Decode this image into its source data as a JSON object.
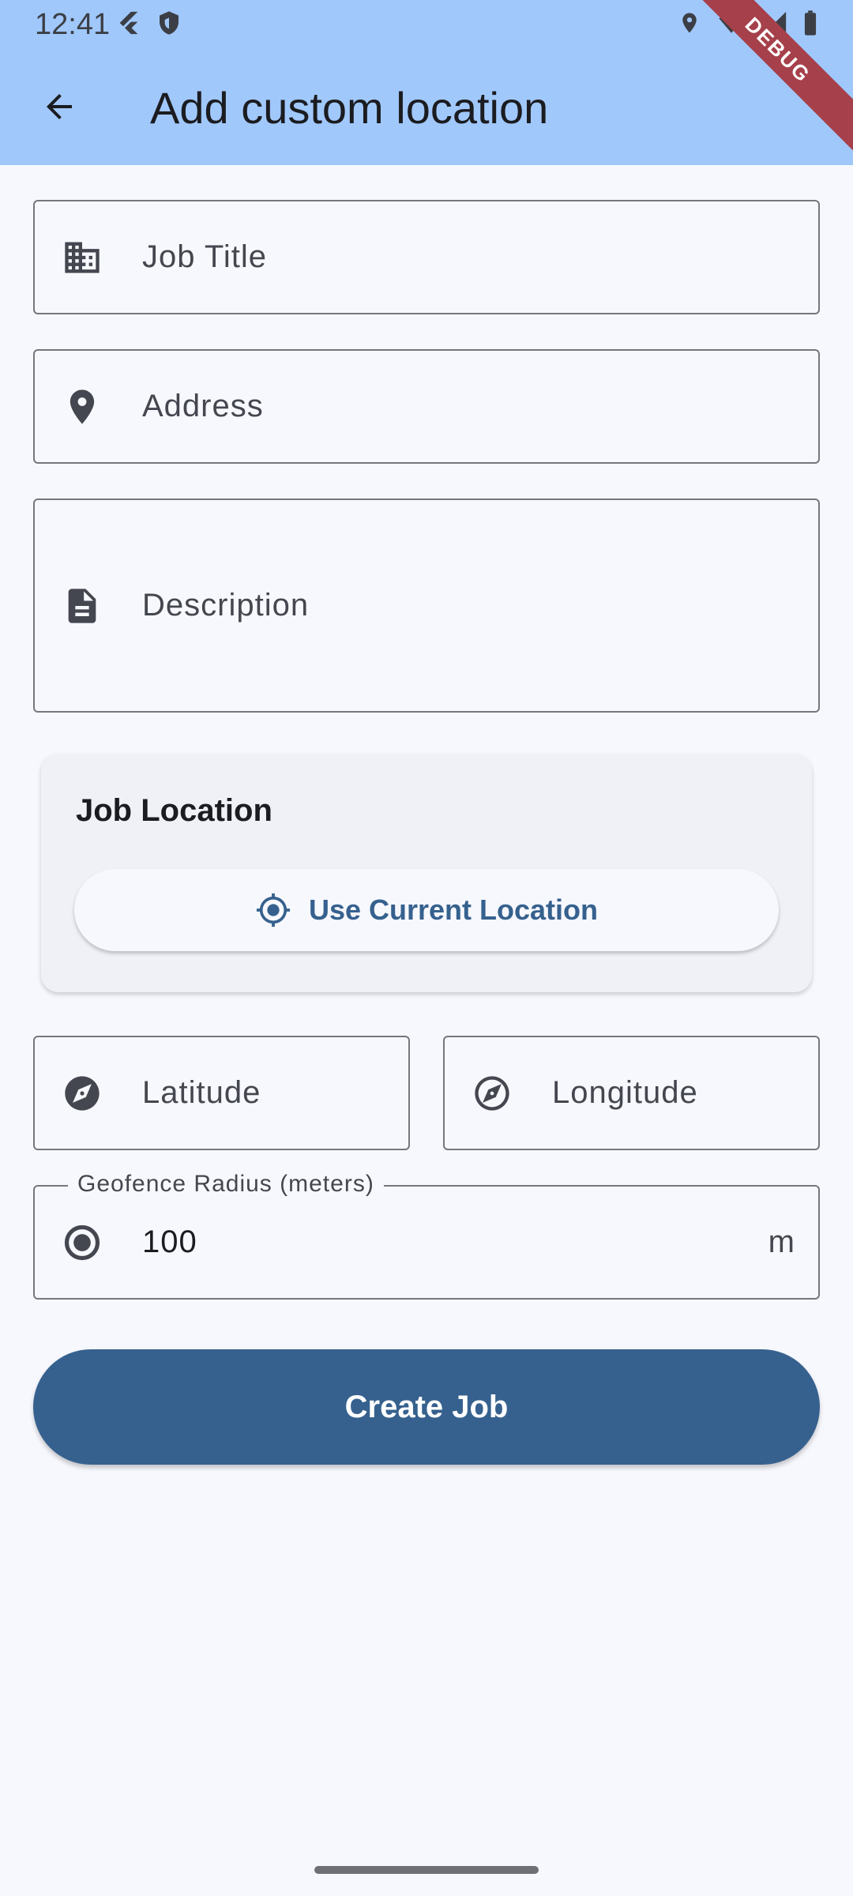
{
  "status_bar": {
    "time": "12:41"
  },
  "app_bar": {
    "title": "Add custom location",
    "debug_banner": "DEBUG"
  },
  "form": {
    "job_title": {
      "placeholder": "Job Title",
      "icon": "building-icon"
    },
    "address": {
      "placeholder": "Address",
      "icon": "location-pin-icon"
    },
    "description": {
      "placeholder": "Description",
      "icon": "document-icon"
    },
    "job_location": {
      "title": "Job Location",
      "use_current_location_label": "Use Current Location",
      "icon": "gps-crosshair-icon"
    },
    "latitude": {
      "placeholder": "Latitude",
      "icon": "compass-filled-icon"
    },
    "longitude": {
      "placeholder": "Longitude",
      "icon": "compass-outline-icon"
    },
    "geofence": {
      "label": "Geofence Radius (meters)",
      "value": "100",
      "suffix": "m",
      "icon": "radio-target-icon"
    },
    "submit_label": "Create Job"
  },
  "colors": {
    "app_bar": "#a1c8fb",
    "primary": "#36618e",
    "background": "#f7f8fd",
    "card": "#f0f1f7",
    "outline": "#74777f",
    "debug_ribbon": "#a6404a"
  }
}
